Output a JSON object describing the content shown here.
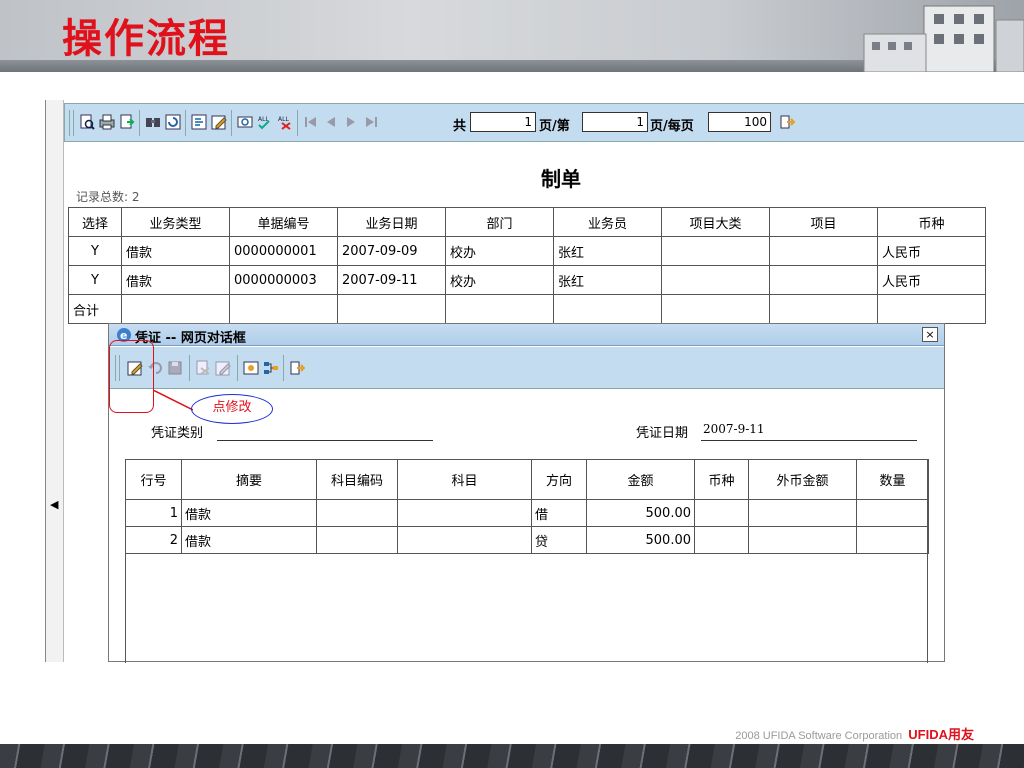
{
  "slide": {
    "title": "操作流程",
    "footer_text": "2008 UFIDA Software Corporation",
    "footer_brand": "UFIDA用友"
  },
  "toolbar": {
    "total_label": "共",
    "total_value": "1",
    "page_label": "页/第",
    "page_value": "1",
    "per_page_label": "页/每页",
    "per_page_value": "100",
    "icons": [
      "preview-icon",
      "print-icon",
      "export-icon",
      "find-icon",
      "refresh-icon",
      "import-icon",
      "edit-icon",
      "filter-icon",
      "select-all-icon",
      "deselect-all-icon",
      "first-page-icon",
      "prev-page-icon",
      "next-page-icon",
      "last-page-icon",
      "exit-icon"
    ]
  },
  "report": {
    "title": "制单",
    "record_count": "记录总数: 2",
    "columns": [
      "选择",
      "业务类型",
      "单据编号",
      "业务日期",
      "部门",
      "业务员",
      "项目大类",
      "项目",
      "币种"
    ],
    "rows": [
      [
        "Y",
        "借款",
        "0000000001",
        "2007-09-09",
        "校办",
        "张红",
        "",
        "",
        "人民币"
      ],
      [
        "Y",
        "借款",
        "0000000003",
        "2007-09-11",
        "校办",
        "张红",
        "",
        "",
        "人民币"
      ]
    ],
    "total_label": "合计"
  },
  "dialog": {
    "title": "凭证  --  网页对话框",
    "close_symbol": "×",
    "callout": "点修改",
    "voucher_type_label": "凭证类别",
    "voucher_type_value": "",
    "voucher_date_label": "凭证日期",
    "voucher_date_value": "2007-9-11",
    "columns": [
      "行号",
      "摘要",
      "科目编码",
      "科目",
      "方向",
      "金额",
      "币种",
      "外币金额",
      "数量"
    ],
    "rows": [
      [
        "1",
        "借款",
        "",
        "",
        "借",
        "500.00",
        "",
        "",
        ""
      ],
      [
        "2",
        "借款",
        "",
        "",
        "贷",
        "500.00",
        "",
        "",
        ""
      ]
    ]
  },
  "colors": {
    "accent_red": "#e0111b",
    "toolbar_blue": "#c3dcf0"
  }
}
